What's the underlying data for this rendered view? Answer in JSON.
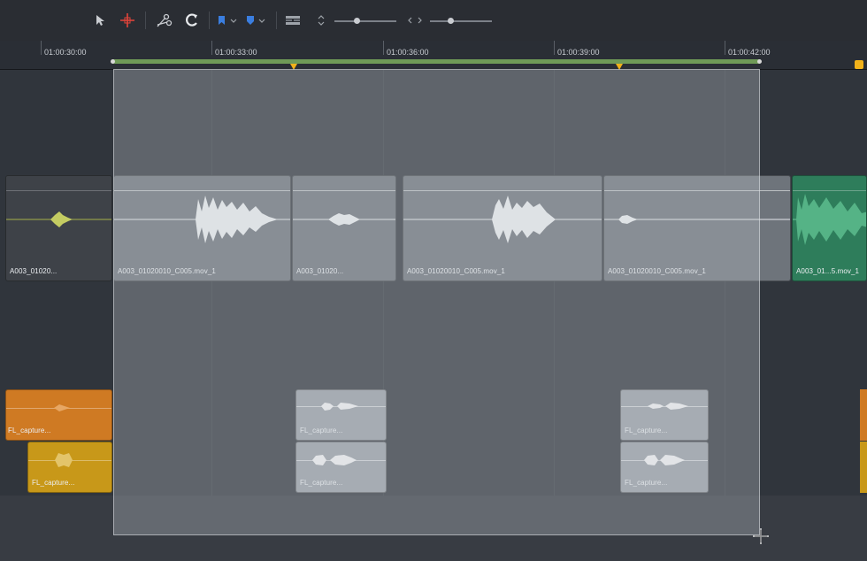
{
  "toolbar": {
    "tools": [
      "pointer-icon",
      "blade-cursor-icon",
      "razor-icon",
      "snap-icon",
      "flag-icon",
      "marker-icon",
      "view-options-icon",
      "height-toggle-icon",
      "zoom-arrows-icon"
    ],
    "colors": {
      "blade": "#e4443a",
      "flag": "#3a7ee0",
      "marker": "#3a7ee0"
    }
  },
  "ruler": {
    "timecodes": [
      "01:00:30:00",
      "01:00:33:00",
      "01:00:36:00",
      "01:00:39:00",
      "01:00:42:00"
    ],
    "colors": {
      "in_out_range": "#6f9a57",
      "marker": "#f2b21a"
    }
  },
  "tracks": {
    "a1": [
      {
        "label": "A003_01020...",
        "color": "#3e4248"
      },
      {
        "label": "A003_01020010_C005.mov_1",
        "color": "#6e747b"
      },
      {
        "label": "A003_01020...",
        "color": "#6e747b"
      },
      {
        "label": "A003_01020010_C005.mov_1",
        "color": "#6e747b"
      },
      {
        "label": "A003_01020010_C005.mov_1",
        "color": "#6e747b"
      },
      {
        "label": "A003_01...5.mov_1",
        "color": "#2e7d5b"
      }
    ],
    "a2": [
      {
        "label": "FL_capture...",
        "color": "#cf7a23"
      },
      {
        "label": "FL_capture...",
        "color": "#9aa0a7"
      },
      {
        "label": "FL_capture...",
        "color": "#9aa0a7"
      }
    ],
    "a3": [
      {
        "label": "FL_capture...",
        "color": "#c89819"
      },
      {
        "label": "FL_capture...",
        "color": "#9aa0a7"
      },
      {
        "label": "FL_capture...",
        "color": "#9aa0a7"
      }
    ]
  }
}
